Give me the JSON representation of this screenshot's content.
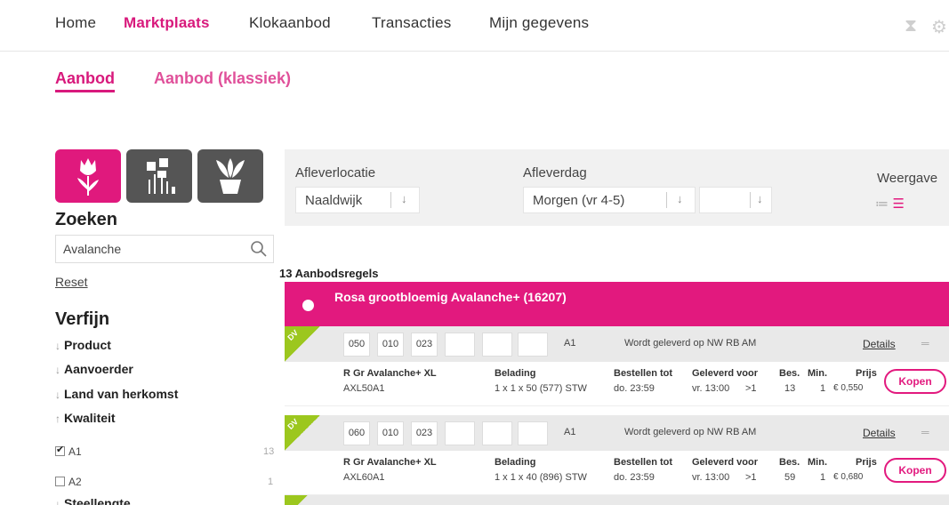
{
  "nav": {
    "items": [
      "Home",
      "Marktplaats",
      "Klokaanbod",
      "Transacties",
      "Mijn gegevens"
    ],
    "active": "Marktplaats"
  },
  "subtabs": [
    "Aanbod",
    "Aanbod (klassiek)"
  ],
  "sidebar": {
    "search_title": "Zoeken",
    "search_value": "Avalanche",
    "reset": "Reset",
    "refine_title": "Verfijn",
    "filters": [
      "Product",
      "Aanvoerder",
      "Land van herkomst",
      "Kwaliteit",
      "Steellengte"
    ],
    "quality_options": [
      {
        "label": "A1",
        "count": "13",
        "checked": true
      },
      {
        "label": "A2",
        "count": "1",
        "checked": false
      }
    ]
  },
  "filterbar": {
    "location_label": "Afleverlocatie",
    "location_value": "Naaldwijk",
    "day_label": "Afleverdag",
    "day_value": "Morgen (vr 4-5)",
    "view_label": "Weergave"
  },
  "results": {
    "count_label": "13 Aanbodsregels",
    "product_title": "Rosa grootbloemig Avalanche+ (16207)",
    "offers": [
      {
        "badge": "DV",
        "codes": [
          "050",
          "010",
          "023"
        ],
        "quality": "A1",
        "delivery_note": "Wordt geleverd op  NW RB AM",
        "details": "Details",
        "name": "R Gr Avalanche+ XL",
        "code": "AXL50A1",
        "belading_label": "Belading",
        "belading": "1 x 1 x 50 (577) STW",
        "order_label": "Bestellen tot",
        "order": "do. 23:59",
        "delivered_label": "Geleverd voor",
        "delivered": "vr. 13:00",
        "delivered_extra": ">1",
        "bes_label": "Bes.",
        "bes": "13",
        "min_label": "Min.",
        "min": "1",
        "price_label": "Prijs",
        "price": "€ 0,550",
        "buy": "Kopen"
      },
      {
        "badge": "DV",
        "codes": [
          "060",
          "010",
          "023"
        ],
        "quality": "A1",
        "delivery_note": "Wordt geleverd op  NW RB AM",
        "details": "Details",
        "name": "R Gr Avalanche+ XL",
        "code": "AXL60A1",
        "belading_label": "Belading",
        "belading": "1 x 1 x 40 (896) STW",
        "order_label": "Bestellen tot",
        "order": "do. 23:59",
        "delivered_label": "Geleverd voor",
        "delivered": "vr. 13:00",
        "delivered_extra": ">1",
        "bes_label": "Bes.",
        "bes": "59",
        "min_label": "Min.",
        "min": "1",
        "price_label": "Prijs",
        "price": "€ 0,680",
        "buy": "Kopen"
      }
    ]
  },
  "colors": {
    "accent": "#e2197e",
    "badge": "#9cc71e"
  }
}
